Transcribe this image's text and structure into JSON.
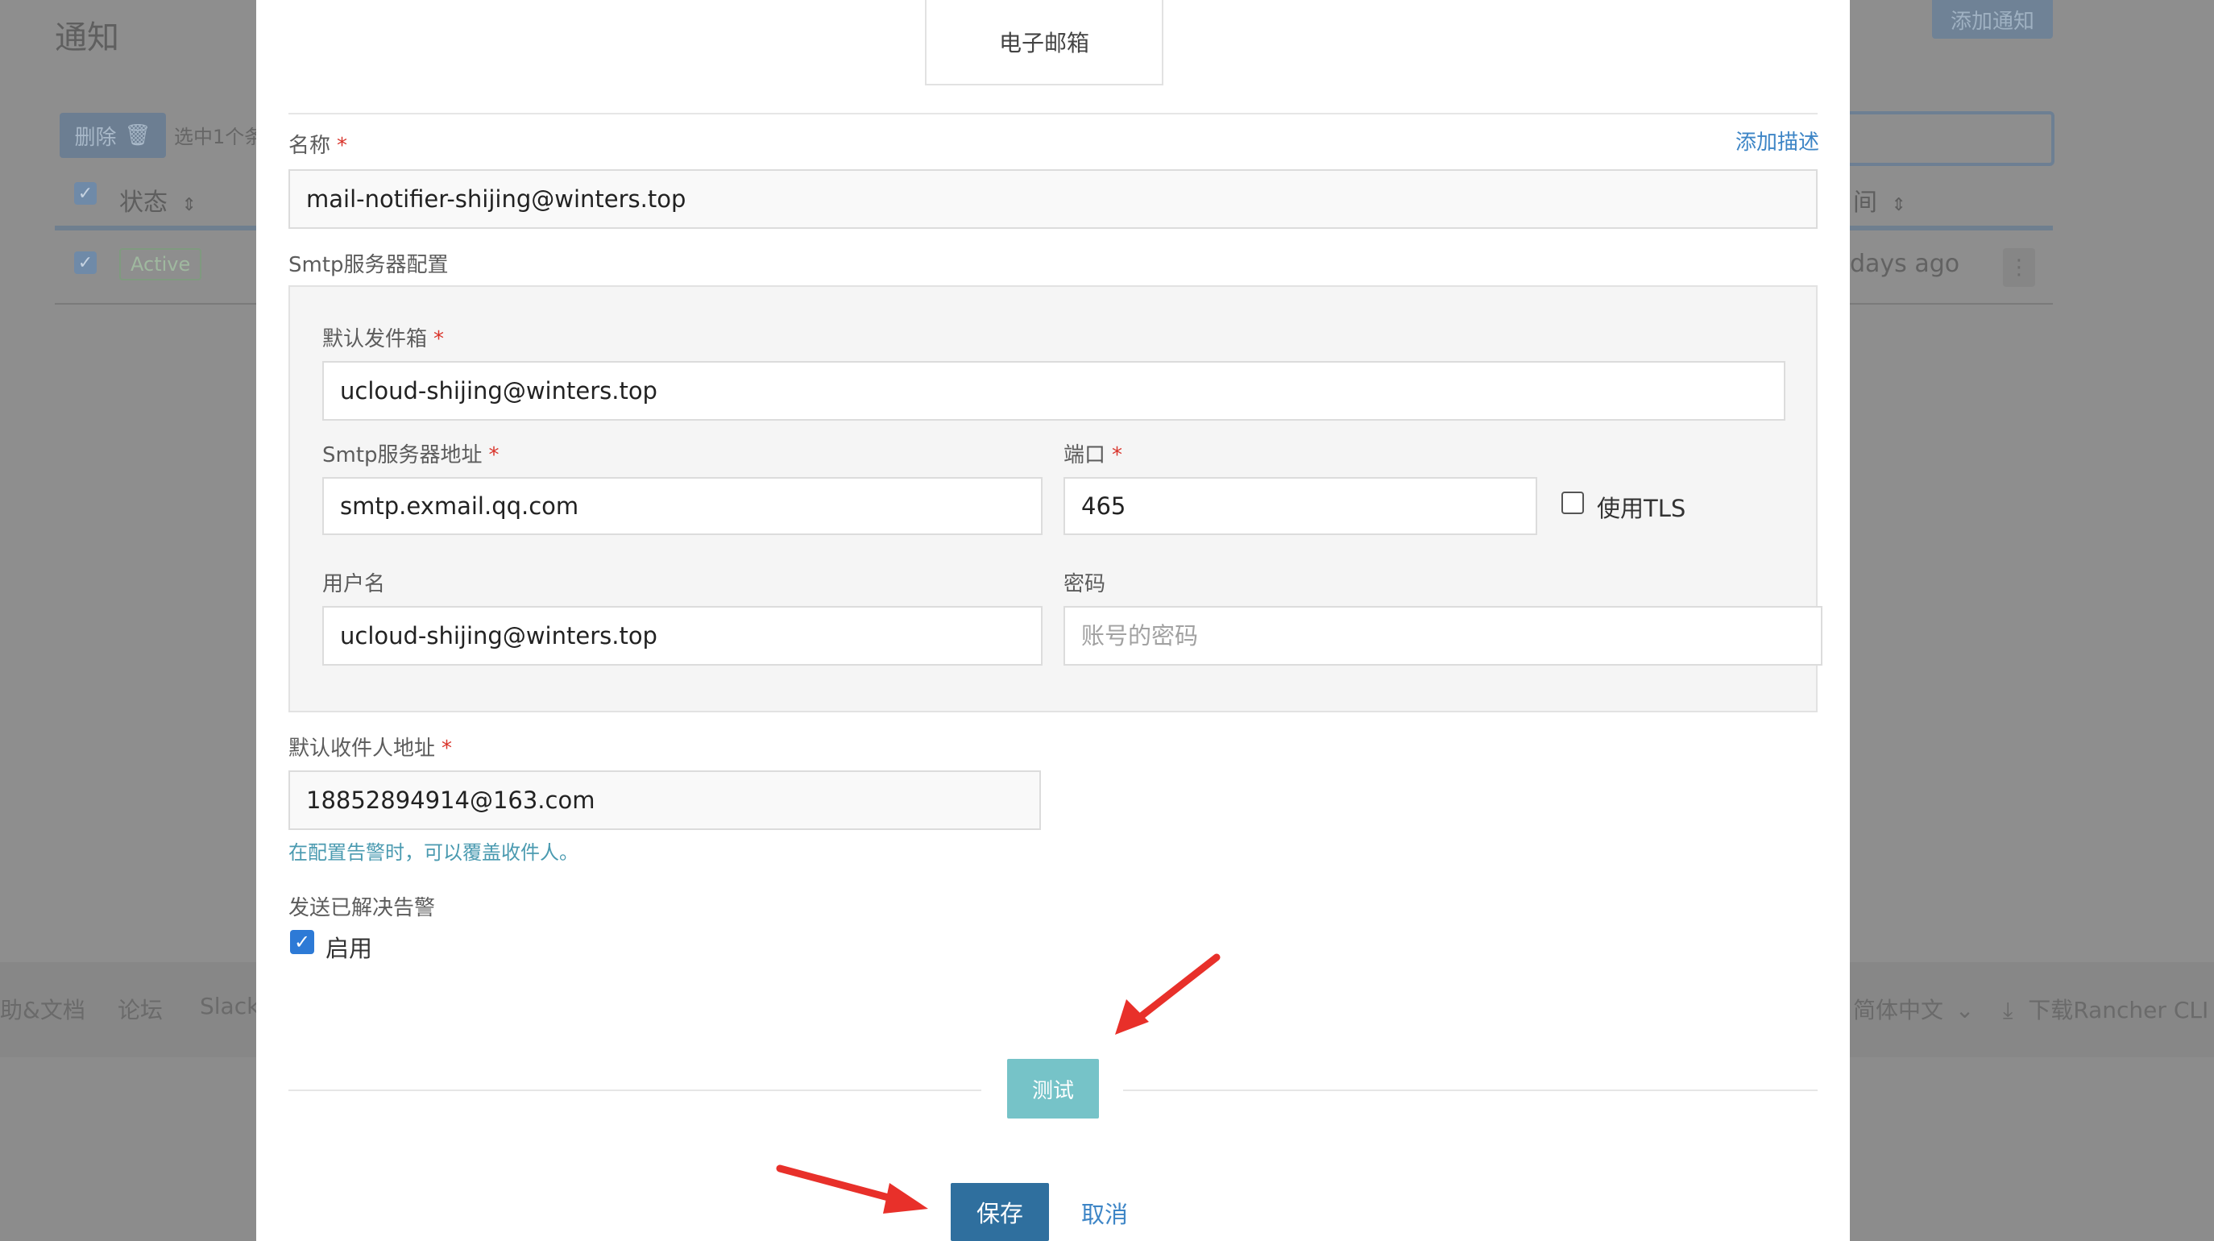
{
  "background": {
    "page_title": "通知",
    "add_button": "添加通知",
    "delete_button": "删除",
    "selected_text": "选中1个条",
    "col_status": "状态",
    "col_time": "间",
    "status_badge": "Active",
    "time_ago": "days ago",
    "footer": {
      "help_docs": "助&文档",
      "forum": "论坛",
      "slack": "Slack",
      "language": "简体中文",
      "download_cli": "下载Rancher CLI"
    }
  },
  "modal": {
    "tab_label": "电子邮箱",
    "name_label": "名称",
    "add_description": "添加描述",
    "name_value": "mail-notifier-shijing@winters.top",
    "smtp_section_label": "Smtp服务器配置",
    "default_sender_label": "默认发件箱",
    "default_sender_value": "ucloud-shijing@winters.top",
    "smtp_host_label": "Smtp服务器地址",
    "smtp_host_value": "smtp.exmail.qq.com",
    "port_label": "端口",
    "port_value": "465",
    "use_tls_label": "使用TLS",
    "use_tls_checked": false,
    "username_label": "用户名",
    "username_value": "ucloud-shijing@winters.top",
    "password_label": "密码",
    "password_placeholder": "账号的密码",
    "recipient_label": "默认收件人地址",
    "recipient_value": "18852894914@163.com",
    "recipient_hint": "在配置告警时，可以覆盖收件人。",
    "send_resolved_label": "发送已解决告警",
    "enable_label": "启用",
    "enable_checked": true,
    "test_button": "测试",
    "save_button": "保存",
    "cancel_button": "取消",
    "required_mark": "*"
  },
  "colors": {
    "primary": "#2f6f9e",
    "test_button": "#76c3c8",
    "link": "#3d85c6",
    "required": "#d9342b",
    "annotation_arrow": "#e8302a"
  }
}
